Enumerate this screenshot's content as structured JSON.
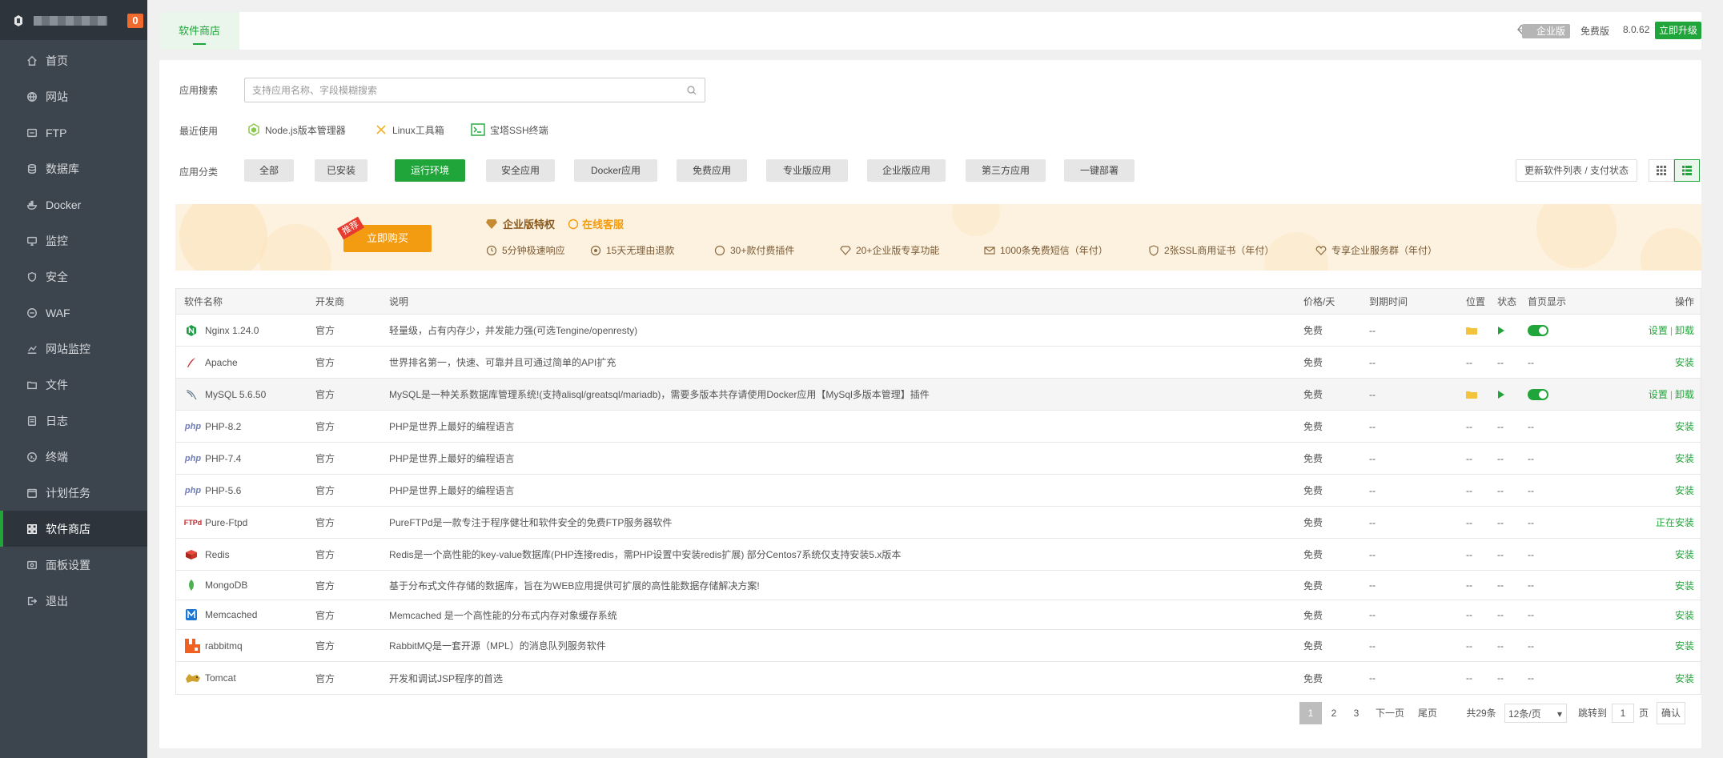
{
  "sidebar": {
    "notify_count": "0",
    "items": [
      {
        "label": "首页",
        "icon": "home-icon"
      },
      {
        "label": "网站",
        "icon": "globe-icon"
      },
      {
        "label": "FTP",
        "icon": "ftp-icon"
      },
      {
        "label": "数据库",
        "icon": "database-icon"
      },
      {
        "label": "Docker",
        "icon": "docker-icon"
      },
      {
        "label": "监控",
        "icon": "monitor-icon"
      },
      {
        "label": "安全",
        "icon": "shield-icon"
      },
      {
        "label": "WAF",
        "icon": "waf-icon"
      },
      {
        "label": "网站监控",
        "icon": "chart-icon"
      },
      {
        "label": "文件",
        "icon": "folder-icon"
      },
      {
        "label": "日志",
        "icon": "log-icon"
      },
      {
        "label": "终端",
        "icon": "terminal-icon"
      },
      {
        "label": "计划任务",
        "icon": "calendar-icon"
      },
      {
        "label": "软件商店",
        "icon": "grid-icon"
      },
      {
        "label": "面板设置",
        "icon": "settings-icon"
      },
      {
        "label": "退出",
        "icon": "logout-icon"
      }
    ],
    "active_index": 13
  },
  "topbar": {
    "tab_label": "软件商店",
    "edition_label": "企业版",
    "free_label": "免费版",
    "version": "8.0.62",
    "upgrade_label": "立即升级"
  },
  "search": {
    "label": "应用搜索",
    "placeholder": "支持应用名称、字段模糊搜索"
  },
  "recent": {
    "label": "最近使用",
    "items": [
      "Node.js版本管理器",
      "Linux工具箱",
      "宝塔SSH终端"
    ]
  },
  "categories": {
    "label": "应用分类",
    "items": [
      "全部",
      "已安装",
      "运行环境",
      "安全应用",
      "Docker应用",
      "免费应用",
      "专业版应用",
      "企业版应用",
      "第三方应用",
      "一键部署"
    ],
    "active_index": 2,
    "refresh_label": "更新软件列表 / 支付状态"
  },
  "banner": {
    "hot_tag": "推荐",
    "buy_label": "立即购买",
    "title": "企业版特权",
    "cs_label": "在线客服",
    "features": [
      "5分钟极速响应",
      "15天无理由退款",
      "30+款付费插件",
      "20+企业版专享功能",
      "1000条免费短信（年付）",
      "2张SSL商用证书（年付）",
      "专享企业服务群（年付）"
    ]
  },
  "table": {
    "headers": {
      "name": "软件名称",
      "dev": "开发商",
      "desc": "说明",
      "price": "价格/天",
      "expire": "到期时间",
      "loc": "位置",
      "status": "状态",
      "home": "首页显示",
      "op": "操作"
    },
    "rows": [
      {
        "name": "Nginx 1.24.0",
        "dev": "官方",
        "desc": "轻量级，占有内存少，并发能力强(可选Tengine/openresty)",
        "price": "免费",
        "expire": "--",
        "installed": true,
        "op1": "设置",
        "op2": "卸载"
      },
      {
        "name": "Apache",
        "dev": "官方",
        "desc": "世界排名第一，快速、可靠并且可通过简单的API扩充",
        "price": "免费",
        "expire": "--",
        "loc": "--",
        "status": "--",
        "home": "--",
        "op": "安装"
      },
      {
        "name": "MySQL 5.6.50",
        "dev": "官方",
        "desc": "MySQL是一种关系数据库管理系统!(支持alisql/greatsql/mariadb)，需要多版本共存请使用Docker应用【MySql多版本管理】插件",
        "price": "免费",
        "expire": "--",
        "installed": true,
        "op1": "设置",
        "op2": "卸载"
      },
      {
        "name": "PHP-8.2",
        "dev": "官方",
        "desc": "PHP是世界上最好的编程语言",
        "price": "免费",
        "expire": "--",
        "loc": "--",
        "status": "--",
        "home": "--",
        "op": "安装"
      },
      {
        "name": "PHP-7.4",
        "dev": "官方",
        "desc": "PHP是世界上最好的编程语言",
        "price": "免费",
        "expire": "--",
        "loc": "--",
        "status": "--",
        "home": "--",
        "op": "安装"
      },
      {
        "name": "PHP-5.6",
        "dev": "官方",
        "desc": "PHP是世界上最好的编程语言",
        "price": "免费",
        "expire": "--",
        "loc": "--",
        "status": "--",
        "home": "--",
        "op": "安装"
      },
      {
        "name": "Pure-Ftpd",
        "dev": "官方",
        "desc": "PureFTPd是一款专注于程序健壮和软件安全的免费FTP服务器软件",
        "price": "免费",
        "expire": "--",
        "loc": "--",
        "status": "--",
        "home": "--",
        "op": "正在安装"
      },
      {
        "name": "Redis",
        "dev": "官方",
        "desc": "Redis是一个高性能的key-value数据库(PHP连接redis，需PHP设置中安装redis扩展) 部分Centos7系统仅支持安装5.x版本",
        "price": "免费",
        "expire": "--",
        "loc": "--",
        "status": "--",
        "home": "--",
        "op": "安装"
      },
      {
        "name": "MongoDB",
        "dev": "官方",
        "desc": "基于分布式文件存储的数据库，旨在为WEB应用提供可扩展的高性能数据存储解决方案!",
        "price": "免费",
        "expire": "--",
        "loc": "--",
        "status": "--",
        "home": "--",
        "op": "安装"
      },
      {
        "name": "Memcached",
        "dev": "官方",
        "desc": "Memcached 是一个高性能的分布式内存对象缓存系统",
        "price": "免费",
        "expire": "--",
        "loc": "--",
        "status": "--",
        "home": "--",
        "op": "安装"
      },
      {
        "name": "rabbitmq",
        "dev": "官方",
        "desc": "RabbitMQ是一套开源（MPL）的消息队列服务软件",
        "price": "免费",
        "expire": "--",
        "loc": "--",
        "status": "--",
        "home": "--",
        "op": "安装"
      },
      {
        "name": "Tomcat",
        "dev": "官方",
        "desc": "开发和调试JSP程序的首选",
        "price": "免费",
        "expire": "--",
        "loc": "--",
        "status": "--",
        "home": "--",
        "op": "安装"
      }
    ]
  },
  "pagination": {
    "pages": [
      "1",
      "2",
      "3"
    ],
    "next": "下一页",
    "last": "尾页",
    "total": "共29条",
    "per_page": "12条/页",
    "jump_label": "跳转到",
    "jump_value": "1",
    "page_unit": "页",
    "confirm": "确认"
  },
  "colors": {
    "brand": "#20a53a",
    "sidebar": "#3c444d",
    "warning": "#f39c12"
  }
}
